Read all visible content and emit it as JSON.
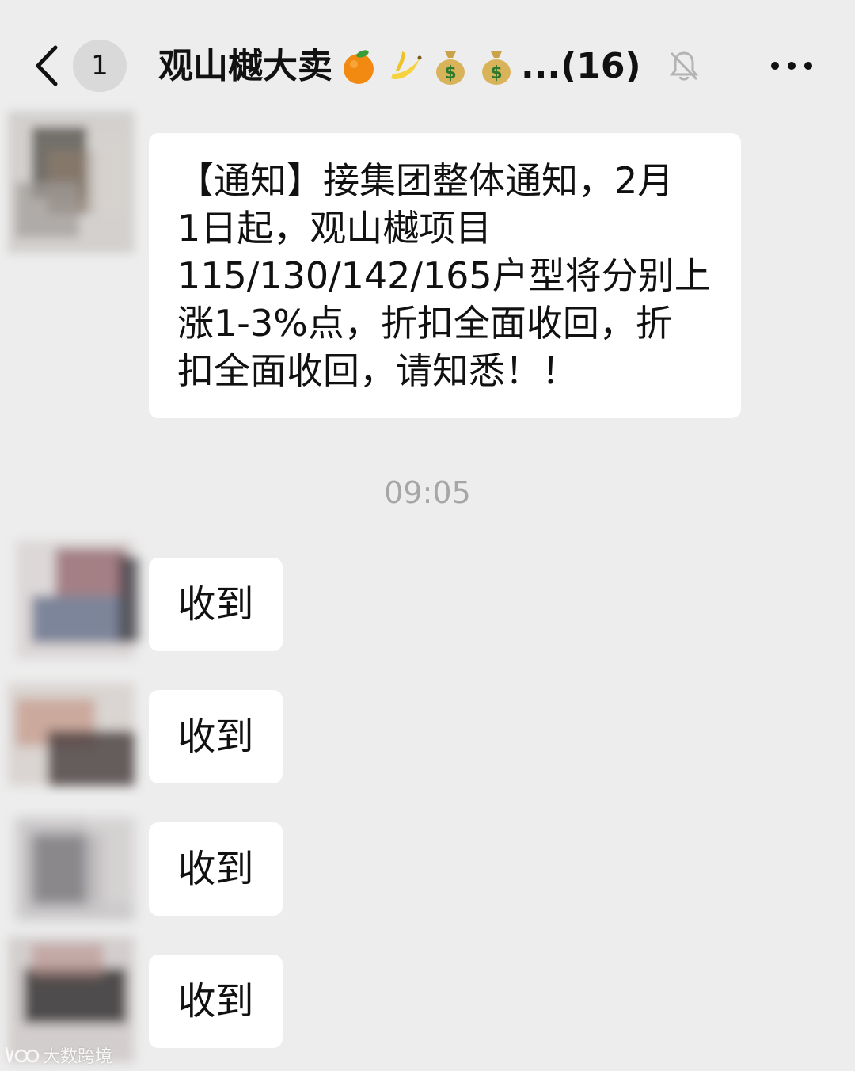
{
  "header": {
    "unread_count": "1",
    "title": "观山樾大卖",
    "title_emojis": [
      "orange-emoji",
      "banana-emoji",
      "money-bag-emoji",
      "money-bag-emoji"
    ],
    "title_suffix": "...(16)",
    "icons": {
      "back": "chevron-left-icon",
      "mute": "bell-off-icon",
      "more": "more-icon"
    }
  },
  "messages": [
    {
      "type": "text",
      "lines": [
        "【通知】接集团整体通知，2月",
        "1日起，观山樾项目",
        "115/130/142/165户型将分别上",
        "涨1-3%点，折扣全面收回，折",
        "扣全面收回，请知悉！！"
      ]
    }
  ],
  "timestamp": "09:05",
  "replies": [
    {
      "text": "收到"
    },
    {
      "text": "收到"
    },
    {
      "text": "收到"
    },
    {
      "text": "收到"
    }
  ],
  "watermark": {
    "text": "大数跨境"
  },
  "colors": {
    "background": "#ededed",
    "bubble": "#ffffff",
    "timestamp": "#a6a6a6",
    "badge": "#d9d9d9"
  }
}
